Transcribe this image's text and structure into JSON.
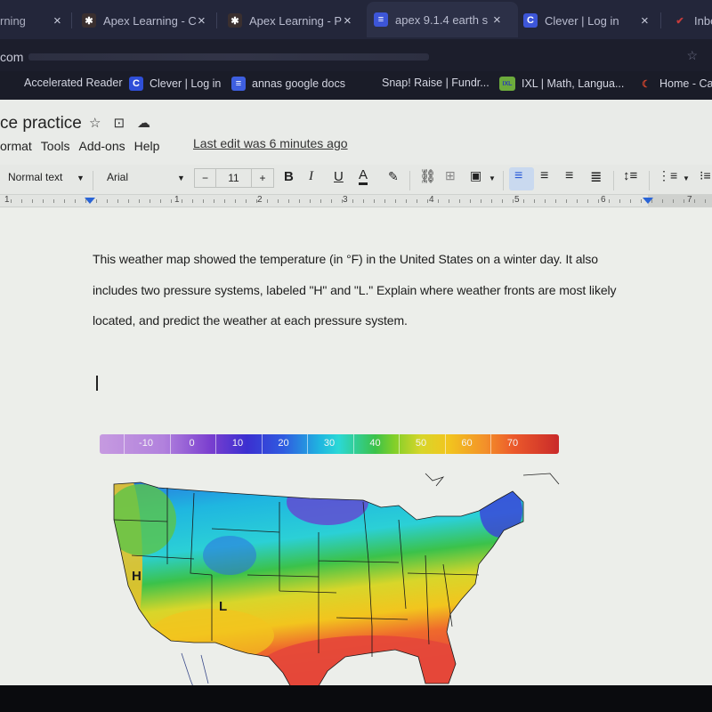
{
  "browser": {
    "tabs": [
      {
        "title": "rning",
        "favicon": "apex-icon",
        "favicon_color": "#2a2d40",
        "close": "×"
      },
      {
        "title": "Apex Learning - C",
        "favicon": "apex-icon",
        "favicon_color": "#3a2f2f",
        "close": "×"
      },
      {
        "title": "Apex Learning - P",
        "favicon": "apex-icon",
        "favicon_color": "#3a2f2f",
        "close": "×"
      },
      {
        "title": "apex 9.1.4 earth s",
        "favicon": "docs-icon",
        "favicon_color": "#3d56d8",
        "close": "×",
        "active": true
      },
      {
        "title": "Clever | Log in",
        "favicon": "clever-icon",
        "favicon_color": "#3d56d8",
        "close": "×"
      },
      {
        "title": "Inbo",
        "favicon": "gmail-icon",
        "favicon_color": "#c53b3b"
      }
    ],
    "address": {
      "visible_text": "com"
    },
    "bookmarks": [
      {
        "label": "Accelerated Reader",
        "favicon": null
      },
      {
        "label": "Clever | Log in",
        "favicon": "clever-icon",
        "favicon_text": "C",
        "favicon_color": "#2f4fd8"
      },
      {
        "label": "annas google docs",
        "favicon": "docs-icon",
        "favicon_text": "≡",
        "favicon_color": "#3e5fe0"
      },
      {
        "label": "Snap! Raise | Fundr...",
        "favicon": null
      },
      {
        "label": "IXL | Math, Langua...",
        "favicon": "ixl-icon",
        "favicon_text": "IXL",
        "favicon_color": "#6dab3c"
      },
      {
        "label": "Home - Ca",
        "favicon": "canvas-icon",
        "favicon_text": "☾",
        "favicon_color": "#d2452d"
      }
    ]
  },
  "docs": {
    "title": "ce practice",
    "title_icons": [
      "star-icon",
      "move-to-folder-icon",
      "cloud-saved-icon"
    ],
    "menu": [
      "ormat",
      "Tools",
      "Add-ons",
      "Help"
    ],
    "last_edit": "Last edit was 6 minutes ago",
    "toolbar": {
      "style": "Normal text",
      "font": "Arial",
      "font_size": "11",
      "decrease": "−",
      "increase": "+",
      "bold": "B",
      "italic": "I",
      "underline": "U",
      "text_color": "A"
    },
    "ruler": {
      "numbers": [
        "1",
        "1",
        "2",
        "3",
        "4",
        "5",
        "6",
        "7"
      ]
    },
    "body": {
      "paragraph": "This weather map showed the temperature (in °F) in the United States on a winter day. It also includes two pressure systems, labeled \"H\" and \"L.\" Explain where weather fronts are most likely located, and predict the weather at each pressure system."
    },
    "map": {
      "legend_unit": "°F",
      "legend_labels": [
        "-10",
        "0",
        "10",
        "20",
        "30",
        "40",
        "50",
        "60",
        "70"
      ],
      "pressure_labels": {
        "high": "H",
        "low": "L"
      },
      "colors": {
        "cold": "#7b3fcf",
        "cool": "#2bd8d6",
        "mild": "#3bc24a",
        "warm": "#f2c51e",
        "hot": "#e4473a"
      }
    }
  }
}
